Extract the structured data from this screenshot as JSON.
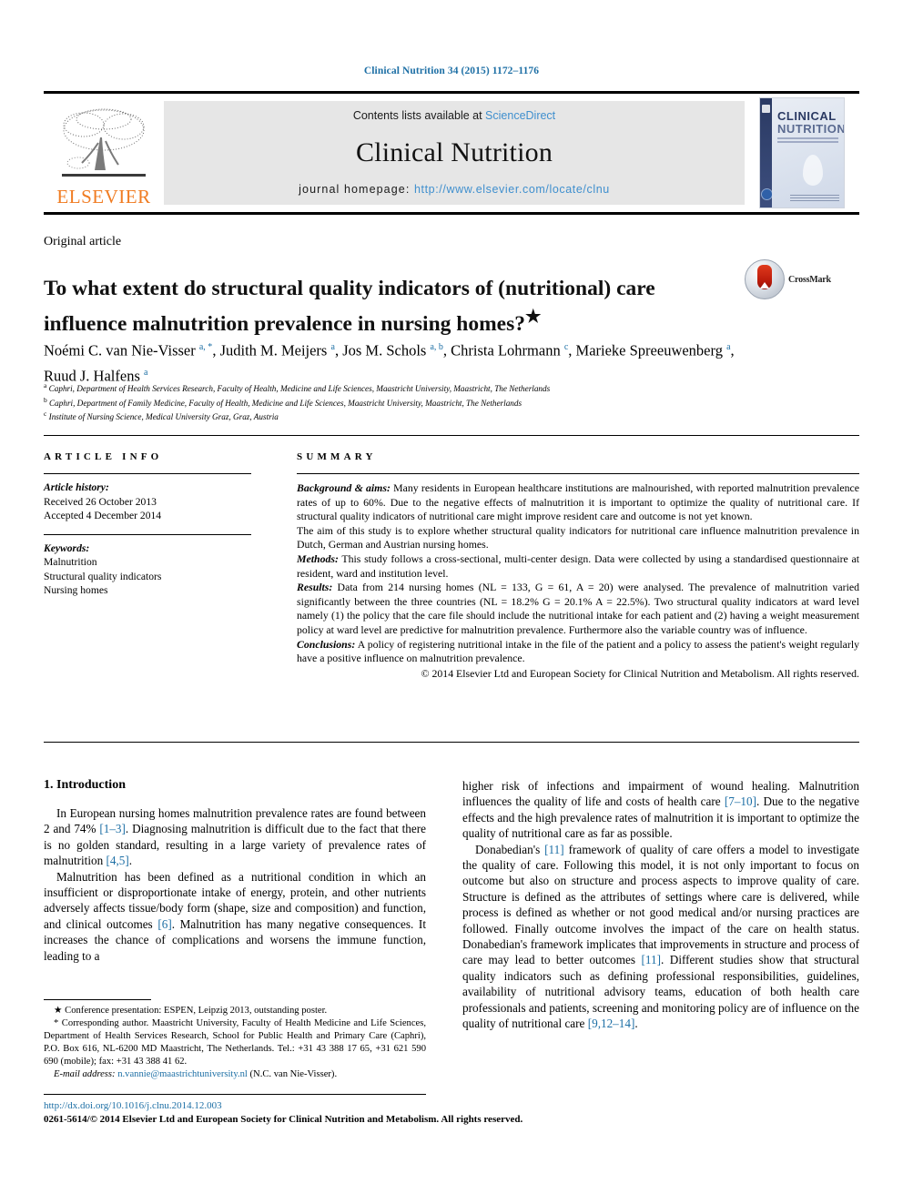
{
  "running_head": "Clinical Nutrition 34 (2015) 1172–1176",
  "masthead": {
    "publisher_name": "ELSEVIER",
    "contents_prefix": "Contents lists available at ",
    "contents_link": "ScienceDirect",
    "journal_title": "Clinical Nutrition",
    "homepage_prefix": "journal homepage: ",
    "homepage_url": "http://www.elsevier.com/locate/clnu",
    "cover": {
      "line1": "CLINICAL",
      "line2": "NUTRITION"
    },
    "colors": {
      "elsevier_orange": "#f07c22",
      "link_blue": "#3f8fce",
      "panel_gray": "#e6e6e6"
    }
  },
  "article": {
    "kicker": "Original article",
    "title": "To what extent do structural quality indicators of (nutritional) care influence malnutrition prevalence in nursing homes?",
    "title_footnote_marker": "★",
    "crossmark_label": "CrossMark",
    "authors": [
      {
        "name": "Noémi C. van Nie-Visser",
        "marks": "a, *"
      },
      {
        "name": "Judith M. Meijers",
        "marks": "a"
      },
      {
        "name": "Jos M. Schols",
        "marks": "a, b"
      },
      {
        "name": "Christa Lohrmann",
        "marks": "c"
      },
      {
        "name": "Marieke Spreeuwenberg",
        "marks": "a"
      },
      {
        "name": "Ruud J. Halfens",
        "marks": "a"
      }
    ],
    "affiliations": [
      {
        "mark": "a",
        "text": "Caphri, Department of Health Services Research, Faculty of Health, Medicine and Life Sciences, Maastricht University, Maastricht, The Netherlands"
      },
      {
        "mark": "b",
        "text": "Caphri, Department of Family Medicine, Faculty of Health, Medicine and Life Sciences, Maastricht University, Maastricht, The Netherlands"
      },
      {
        "mark": "c",
        "text": "Institute of Nursing Science, Medical University Graz, Graz, Austria"
      }
    ]
  },
  "article_info": {
    "heading": "ARTICLE INFO",
    "history_label": "Article history:",
    "received": "Received 26 October 2013",
    "accepted": "Accepted 4 December 2014",
    "keywords_label": "Keywords:",
    "keywords": [
      "Malnutrition",
      "Structural quality indicators",
      "Nursing homes"
    ]
  },
  "summary": {
    "heading": "SUMMARY",
    "sections": [
      {
        "label": "Background & aims:",
        "text": " Many residents in European healthcare institutions are malnourished, with reported malnutrition prevalence rates of up to 60%. Due to the negative effects of malnutrition it is important to optimize the quality of nutritional care. If structural quality indicators of nutritional care might improve resident care and outcome is not yet known."
      },
      {
        "label": "",
        "text": "The aim of this study is to explore whether structural quality indicators for nutritional care influence malnutrition prevalence in Dutch, German and Austrian nursing homes."
      },
      {
        "label": "Methods:",
        "text": " This study follows a cross-sectional, multi-center design. Data were collected by using a standardised questionnaire at resident, ward and institution level."
      },
      {
        "label": "Results:",
        "text": " Data from 214 nursing homes (NL = 133, G = 61, A = 20) were analysed. The prevalence of malnutrition varied significantly between the three countries (NL = 18.2% G = 20.1% A = 22.5%). Two structural quality indicators at ward level namely (1) the policy that the care file should include the nutritional intake for each patient and (2) having a weight measurement policy at ward level are predictive for malnutrition prevalence. Furthermore also the variable country was of influence."
      },
      {
        "label": "Conclusions:",
        "text": " A policy of registering nutritional intake in the file of the patient and a policy to assess the patient's weight regularly have a positive influence on malnutrition prevalence."
      }
    ],
    "copyright": "© 2014 Elsevier Ltd and European Society for Clinical Nutrition and Metabolism. All rights reserved."
  },
  "introduction": {
    "heading": "1. Introduction",
    "left_paragraphs": [
      {
        "segments": [
          {
            "t": "In European nursing homes malnutrition prevalence rates are found between 2 and 74% "
          },
          {
            "t": "[1–3]",
            "ref": true
          },
          {
            "t": ". Diagnosing malnutrition is difficult due to the fact that there is no golden standard, resulting in a large variety of prevalence rates of malnutrition "
          },
          {
            "t": "[4,5]",
            "ref": true
          },
          {
            "t": "."
          }
        ]
      },
      {
        "segments": [
          {
            "t": "Malnutrition has been defined as a nutritional condition in which an insufficient or disproportionate intake of energy, protein, and other nutrients adversely affects tissue/body form (shape, size and composition) and function, and clinical outcomes "
          },
          {
            "t": "[6]",
            "ref": true
          },
          {
            "t": ". Malnutrition has many negative consequences. It increases the chance of complications and worsens the immune function, leading to a"
          }
        ]
      }
    ],
    "right_paragraphs": [
      {
        "indent": false,
        "segments": [
          {
            "t": "higher risk of infections and impairment of wound healing. Malnutrition influences the quality of life and costs of health care "
          },
          {
            "t": "[7–10]",
            "ref": true
          },
          {
            "t": ". Due to the negative effects and the high prevalence rates of malnutrition it is important to optimize the quality of nutritional care as far as possible."
          }
        ]
      },
      {
        "indent": true,
        "segments": [
          {
            "t": "Donabedian's "
          },
          {
            "t": "[11]",
            "ref": true
          },
          {
            "t": " framework of quality of care offers a model to investigate the quality of care. Following this model, it is not only important to focus on outcome but also on structure and process aspects to improve quality of care. Structure is defined as the attributes of settings where care is delivered, while process is defined as whether or not good medical and/or nursing practices are followed. Finally outcome involves the impact of the care on health status. Donabedian's framework implicates that improvements in structure and process of care may lead to better outcomes "
          },
          {
            "t": "[11]",
            "ref": true
          },
          {
            "t": ". Different studies show that structural quality indicators such as defining professional responsibilities, guidelines, availability of nutritional advisory teams, education of both health care professionals and patients, screening and monitoring policy are of influence on the quality of nutritional care "
          },
          {
            "t": "[9,12–14]",
            "ref": true
          },
          {
            "t": "."
          }
        ]
      }
    ]
  },
  "footnotes": {
    "conference": "★ Conference presentation: ESPEN, Leipzig 2013, outstanding poster.",
    "corresponding": "* Corresponding author. Maastricht University, Faculty of Health Medicine and Life Sciences, Department of Health Services Research, School for Public Health and Primary Care (Caphri), P.O. Box 616, NL-6200 MD Maastricht, The Netherlands. Tel.: +31 43 388 17 65, +31 621 590 690 (mobile); fax: +31 43 388 41 62.",
    "email_label": "E-mail address:",
    "email": "n.vannie@maastrichtuniversity.nl",
    "email_owner": "(N.C. van Nie-Visser)."
  },
  "doi_block": {
    "doi_url": "http://dx.doi.org/10.1016/j.clnu.2014.12.003",
    "issn_line": "0261-5614/© 2014 Elsevier Ltd and European Society for Clinical Nutrition and Metabolism. All rights reserved."
  }
}
